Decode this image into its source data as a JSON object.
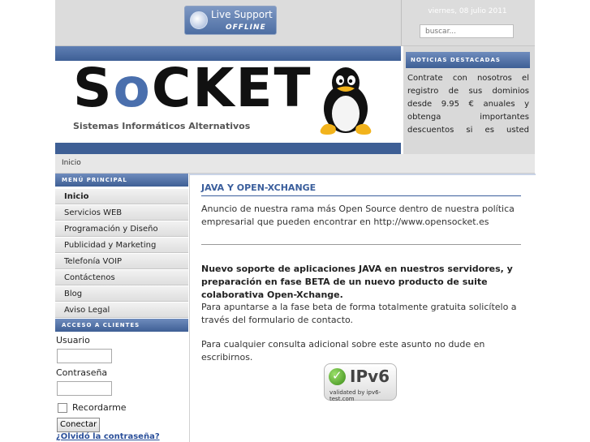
{
  "header": {
    "live_support": {
      "title": "Live Support",
      "status": "OFFLINE"
    },
    "date": "viernes, 08 julio 2011",
    "search_placeholder": "buscar..."
  },
  "banner": {
    "logo_prefix": "S",
    "logo_o": "o",
    "logo_rest": "CKET",
    "subtitle": "Sistemas Informáticos Alternativos"
  },
  "news": {
    "heading": "NOTICIAS DESTACADAS",
    "text": "Contrate con nosotros el registro de sus dominios desde 9.95 € anuales y obtenga importantes descuentos si es usted distribuidor."
  },
  "breadcrumb": "Inicio",
  "menu": {
    "heading": "MENÚ PRINCIPAL",
    "items": [
      "Inicio",
      "Servicios WEB",
      "Programación y Diseño",
      "Publicidad y Marketing",
      "Telefonía VOIP",
      "Contáctenos",
      "Blog",
      "Aviso Legal"
    ]
  },
  "login": {
    "heading": "ACCESO A CLIENTES",
    "user_label": "Usuario",
    "password_label": "Contraseña",
    "remember_label": "Recordarme",
    "submit_label": "Conectar",
    "forgot_label": "¿Olvidó la contraseña?"
  },
  "article": {
    "title": "JAVA Y OPEN-XCHANGE",
    "intro": "Anuncio de nuestra rama más Open Source dentro de nuestra política empresarial que pueden encontrar en http://www.opensocket.es",
    "bold_text": "Nuevo soporte de aplicaciones JAVA en nuestros servidores, y preparación en fase BETA de un nuevo producto de suite colaborativa Open-Xchange.",
    "p2": "Para apuntarse a la fase beta de forma totalmente gratuita solicítelo a través del formulario de contacto.",
    "p3": "Para cualquier consulta adicional sobre este asunto no dude en escribirnos."
  },
  "badge": {
    "big": "IPv6",
    "small": "validated by ipv6-test.com",
    "icon": "check-icon"
  },
  "colors": {
    "accent_blue": "#3e5f95",
    "title_blue": "#3a5e9c",
    "link_blue": "#2a4f9a"
  }
}
